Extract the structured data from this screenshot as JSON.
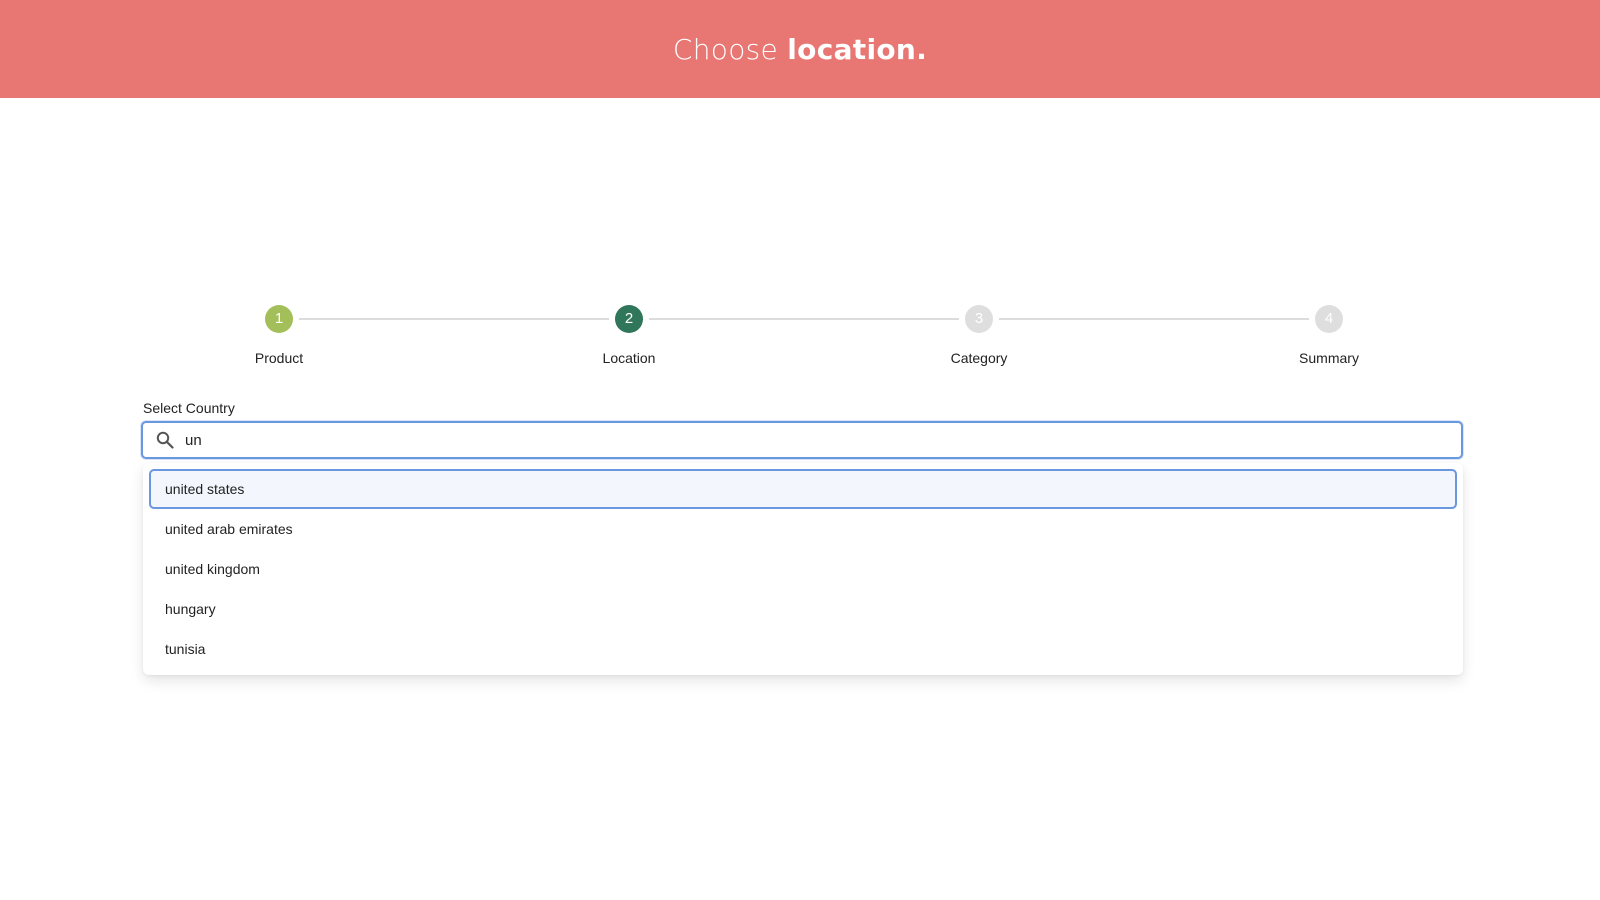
{
  "header": {
    "title_regular": "Choose ",
    "title_bold": "location.",
    "background_color": "#e87673"
  },
  "stepper": {
    "steps": [
      {
        "number": "1",
        "label": "Product",
        "color": "#a3bf5a",
        "state": "completed"
      },
      {
        "number": "2",
        "label": "Location",
        "color": "#2f765a",
        "state": "active"
      },
      {
        "number": "3",
        "label": "Category",
        "color": "#dedede",
        "state": "upcoming"
      },
      {
        "number": "4",
        "label": "Summary",
        "color": "#dedede",
        "state": "upcoming"
      }
    ]
  },
  "country_select": {
    "label": "Select Country",
    "icon": "search-icon",
    "value": "un",
    "accent_color": "#6a98e0",
    "options": [
      {
        "label": "united states",
        "highlighted": true
      },
      {
        "label": "united arab emirates",
        "highlighted": false
      },
      {
        "label": "united kingdom",
        "highlighted": false
      },
      {
        "label": "hungary",
        "highlighted": false
      },
      {
        "label": "tunisia",
        "highlighted": false
      }
    ]
  }
}
